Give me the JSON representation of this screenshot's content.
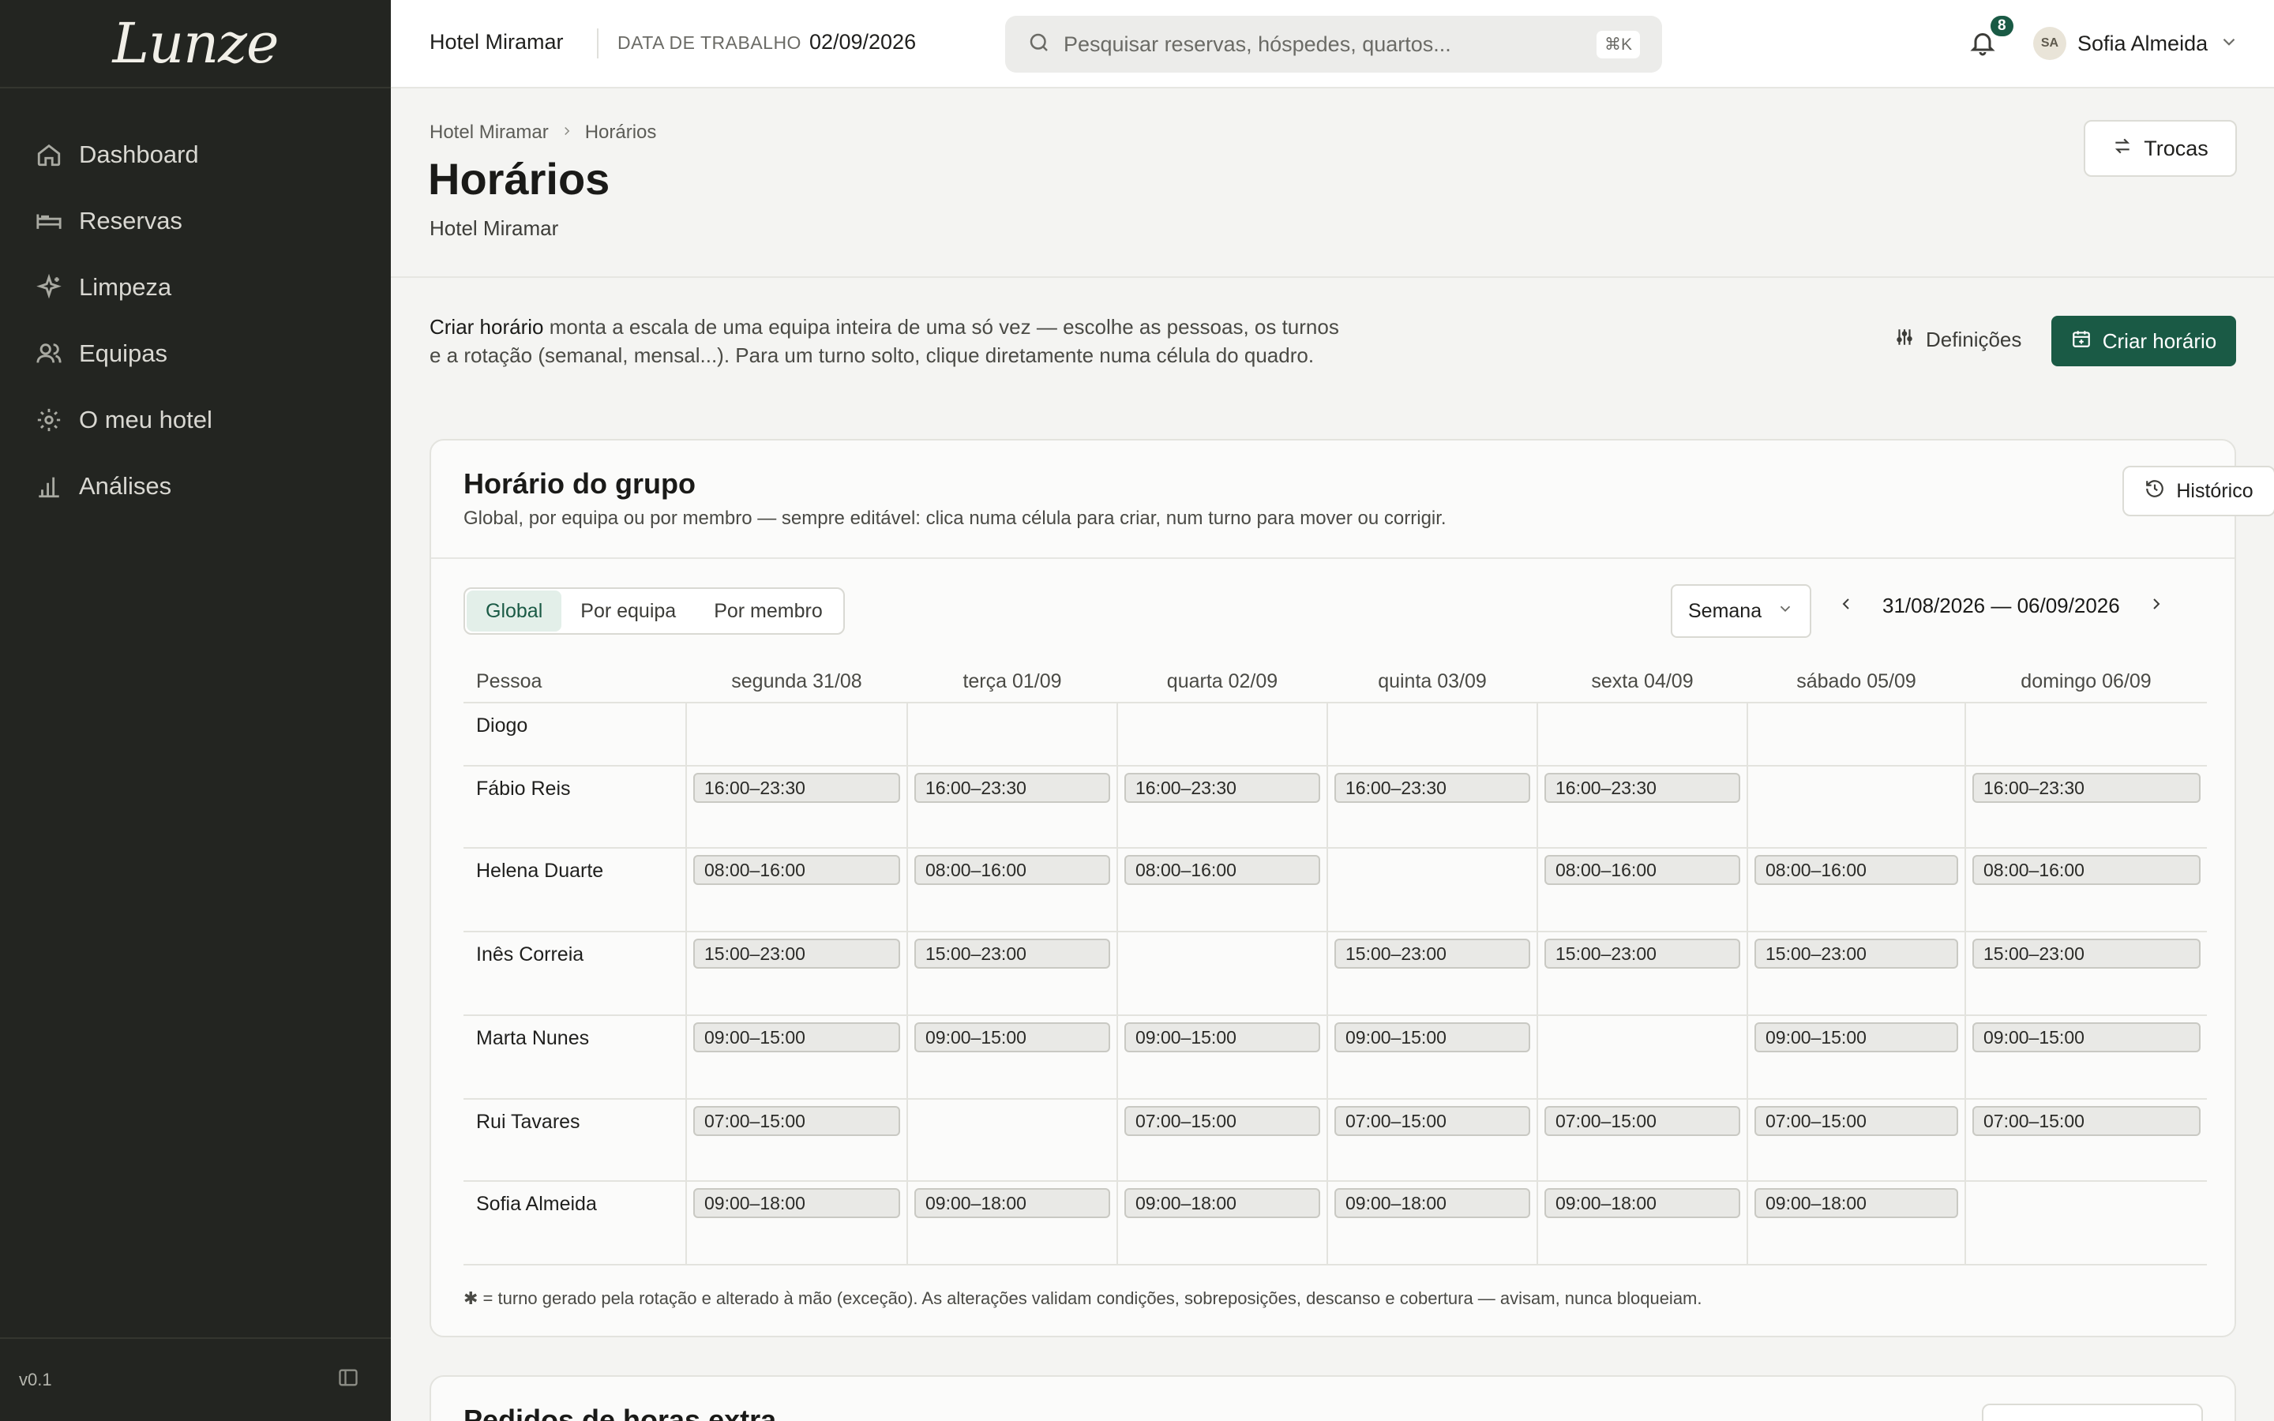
{
  "app": {
    "logo": "Lunze",
    "version": "v0.1"
  },
  "sidebar": {
    "items": [
      {
        "label": "Dashboard",
        "icon": "home-icon"
      },
      {
        "label": "Reservas",
        "icon": "bed-icon"
      },
      {
        "label": "Limpeza",
        "icon": "sparkle-icon"
      },
      {
        "label": "Equipas",
        "icon": "users-icon"
      },
      {
        "label": "O meu hotel",
        "icon": "gear-icon"
      },
      {
        "label": "Análises",
        "icon": "bar-chart-icon"
      }
    ]
  },
  "topbar": {
    "hotel": "Hotel Miramar",
    "work_date_label": "DATA DE TRABALHO",
    "work_date": "02/09/2026",
    "search_placeholder": "Pesquisar reservas, hóspedes, quartos...",
    "search_shortcut": "⌘K",
    "notifications_count": "8",
    "user_initials": "SA",
    "user_name": "Sofia Almeida"
  },
  "page": {
    "breadcrumb": [
      "Hotel Miramar",
      "Horários"
    ],
    "title": "Horários",
    "subtitle": "Hotel Miramar",
    "swaps_label": "Trocas"
  },
  "intro": {
    "strong": "Criar horário",
    "text": " monta a escala de uma equipa inteira de uma só vez — escolhe as pessoas, os turnos e a rotação (semanal, mensal...). Para um turno solto, clique diretamente numa célula do quadro.",
    "settings_label": "Definições",
    "create_label": "Criar horário"
  },
  "schedule": {
    "title": "Horário do grupo",
    "subtitle": "Global, por equipa ou por membro — sempre editável: clica numa célula para criar, num turno para mover ou corrigir.",
    "history_label": "Histórico",
    "tabs": [
      "Global",
      "Por equipa",
      "Por membro"
    ],
    "active_tab": "Global",
    "view_select": "Semana",
    "range": "31/08/2026 — 06/09/2026",
    "person_header": "Pessoa",
    "days": [
      "segunda 31/08",
      "terça 01/09",
      "quarta 02/09",
      "quinta 03/09",
      "sexta 04/09",
      "sábado 05/09",
      "domingo 06/09"
    ],
    "rows": [
      {
        "name": "Diogo",
        "shifts": [
          "",
          "",
          "",
          "",
          "",
          "",
          ""
        ]
      },
      {
        "name": "Fábio Reis",
        "shifts": [
          "16:00–23:30",
          "16:00–23:30",
          "16:00–23:30",
          "16:00–23:30",
          "16:00–23:30",
          "",
          "16:00–23:30"
        ]
      },
      {
        "name": "Helena Duarte",
        "shifts": [
          "08:00–16:00",
          "08:00–16:00",
          "08:00–16:00",
          "",
          "08:00–16:00",
          "08:00–16:00",
          "08:00–16:00"
        ]
      },
      {
        "name": "Inês Correia",
        "shifts": [
          "15:00–23:00",
          "15:00–23:00",
          "",
          "15:00–23:00",
          "15:00–23:00",
          "15:00–23:00",
          "15:00–23:00"
        ]
      },
      {
        "name": "Marta Nunes",
        "shifts": [
          "09:00–15:00",
          "09:00–15:00",
          "09:00–15:00",
          "09:00–15:00",
          "",
          "09:00–15:00",
          "09:00–15:00"
        ]
      },
      {
        "name": "Rui Tavares",
        "shifts": [
          "07:00–15:00",
          "",
          "07:00–15:00",
          "07:00–15:00",
          "07:00–15:00",
          "07:00–15:00",
          "07:00–15:00"
        ]
      },
      {
        "name": "Sofia Almeida",
        "shifts": [
          "09:00–18:00",
          "09:00–18:00",
          "09:00–18:00",
          "09:00–18:00",
          "09:00–18:00",
          "09:00–18:00",
          ""
        ]
      }
    ],
    "footnote": "✱ = turno gerado pela rotação e alterado à mão (exceção). As alterações validam condições, sobreposições, descanso e cobertura — avisam, nunca bloqueiam."
  },
  "overtime": {
    "title": "Pedidos de horas extra"
  },
  "colors": {
    "sidebar_bg": "#232521",
    "accent": "#1a5a45",
    "page_bg": "#f4f4f2"
  }
}
